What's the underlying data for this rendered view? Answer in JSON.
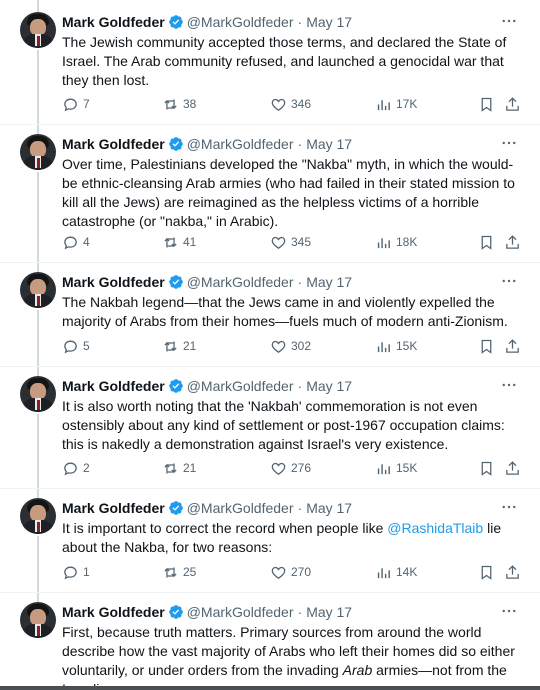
{
  "author": {
    "name": "Mark Goldfeder",
    "handle": "@MarkGoldfeder",
    "separator": "·"
  },
  "icons": {
    "verified": "verified-badge-icon",
    "more": "more-dots-icon",
    "reply": "reply-icon",
    "retweet": "retweet-icon",
    "like": "heart-icon",
    "views": "views-bar-chart-icon",
    "bookmark": "bookmark-icon",
    "share": "share-icon"
  },
  "colors": {
    "accent": "#1d9bf0",
    "muted": "#536471",
    "text": "#0f1419"
  },
  "tweets": [
    {
      "date": "May 17",
      "text": "The Jewish community accepted those terms, and declared the State of Israel. The Arab community refused, and launched a genocidal war that they then lost.",
      "replies": "7",
      "retweets": "38",
      "likes": "346",
      "views": "17K"
    },
    {
      "date": "May 17",
      "text": "Over time, Palestinians developed the \"Nakba\" myth, in which the would-be ethnic-cleansing Arab armies (who had failed in their stated mission to kill all the Jews) are reimagined as the helpless victims of a horrible catastrophe (or \"nakba,\" in Arabic).",
      "replies": "4",
      "retweets": "41",
      "likes": "345",
      "views": "18K"
    },
    {
      "date": "May 17",
      "text": "The Nakbah legend—that the Jews came in and violently expelled the majority of Arabs from their homes—fuels much of modern anti-Zionism.",
      "replies": "5",
      "retweets": "21",
      "likes": "302",
      "views": "15K"
    },
    {
      "date": "May 17",
      "text": "It is also worth noting that the 'Nakbah' commemoration is not even ostensibly about any kind of settlement or post-1967 occupation claims: this is nakedly a demonstration against Israel's very existence.",
      "replies": "2",
      "retweets": "21",
      "likes": "276",
      "views": "15K"
    },
    {
      "date": "May 17",
      "text_before": "It is important to correct the record when people like ",
      "mention": "@RashidaTlaib",
      "text_after": " lie about the Nakba, for two reasons:",
      "replies": "1",
      "retweets": "25",
      "likes": "270",
      "views": "14K"
    },
    {
      "date": "May 17",
      "text_before": "First, because truth matters. Primary sources from around the world describe how the vast majority of Arabs who left their homes did so either voluntarily, or under orders from the invading ",
      "emphasis": "Arab",
      "text_after": " armies—not from the Israelis."
    }
  ]
}
